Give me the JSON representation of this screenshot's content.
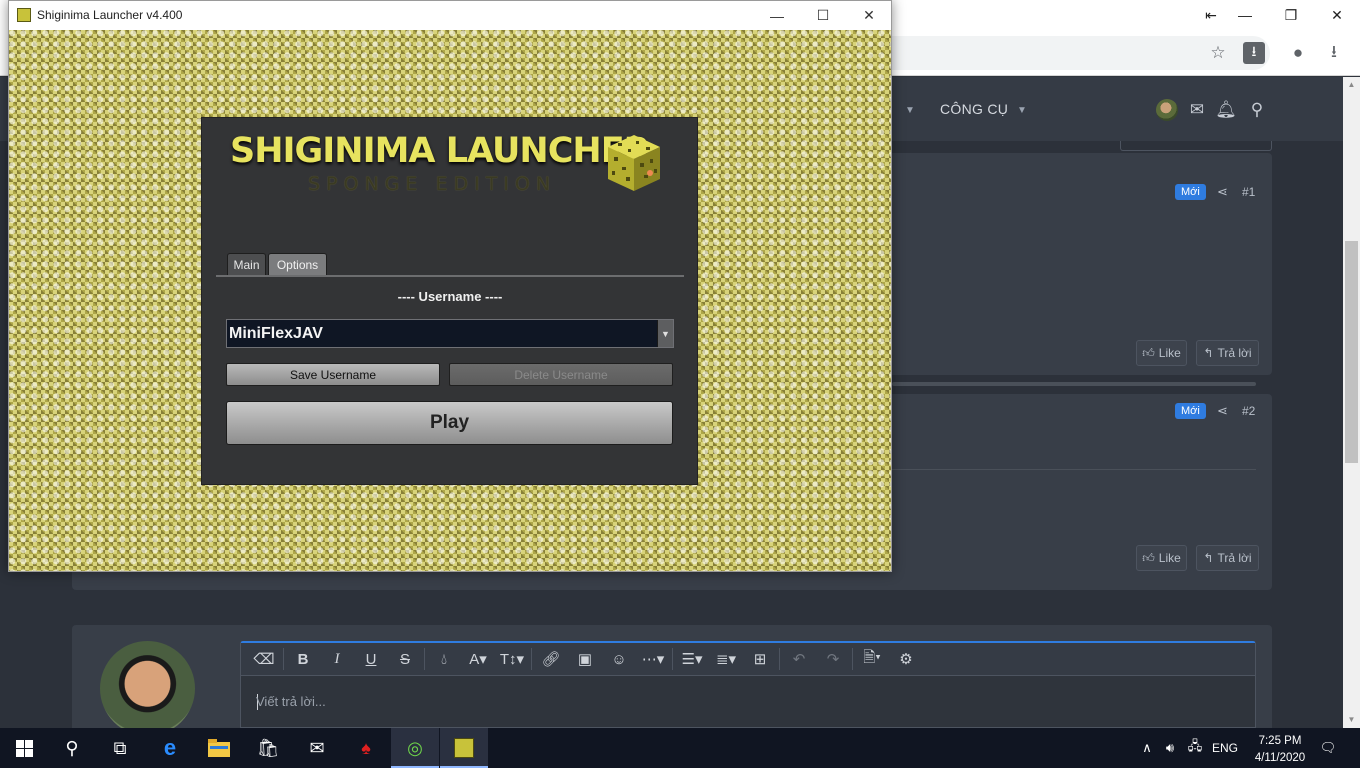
{
  "launcher": {
    "title": "Shiginima Launcher v4.400",
    "logo_main": "SHIGINIMA LAUNCHER",
    "logo_sub": "SPONGE EDITION",
    "tabs": [
      {
        "label": "Main",
        "active": true
      },
      {
        "label": "Options",
        "active": false
      }
    ],
    "username_label": "---- Username ----",
    "username_value": "MiniFlexJAV",
    "save_label": "Save Username",
    "delete_label": "Delete Username",
    "play_label": "Play",
    "controls": {
      "minimize": "minimize-icon",
      "maximize": "maximize-icon",
      "close": "close-icon"
    }
  },
  "browser": {
    "nav_tools_label": "CÔNG CỤ",
    "posts": [
      {
        "badge": "Mới",
        "number": "#1",
        "like": "Like",
        "reply": "Trả lời"
      },
      {
        "badge": "Mới",
        "number": "#2",
        "like": "Like",
        "reply": "Trả lời"
      }
    ],
    "editor_placeholder": "Viết trả lời..."
  },
  "taskbar": {
    "language": "ENG",
    "time": "7:25 PM",
    "date": "4/11/2020"
  },
  "colors": {
    "accent_blue": "#2f7ce0",
    "logo_yellow": "#e7e35f",
    "panel_bg": "#333436",
    "site_bg": "#2c313a"
  }
}
